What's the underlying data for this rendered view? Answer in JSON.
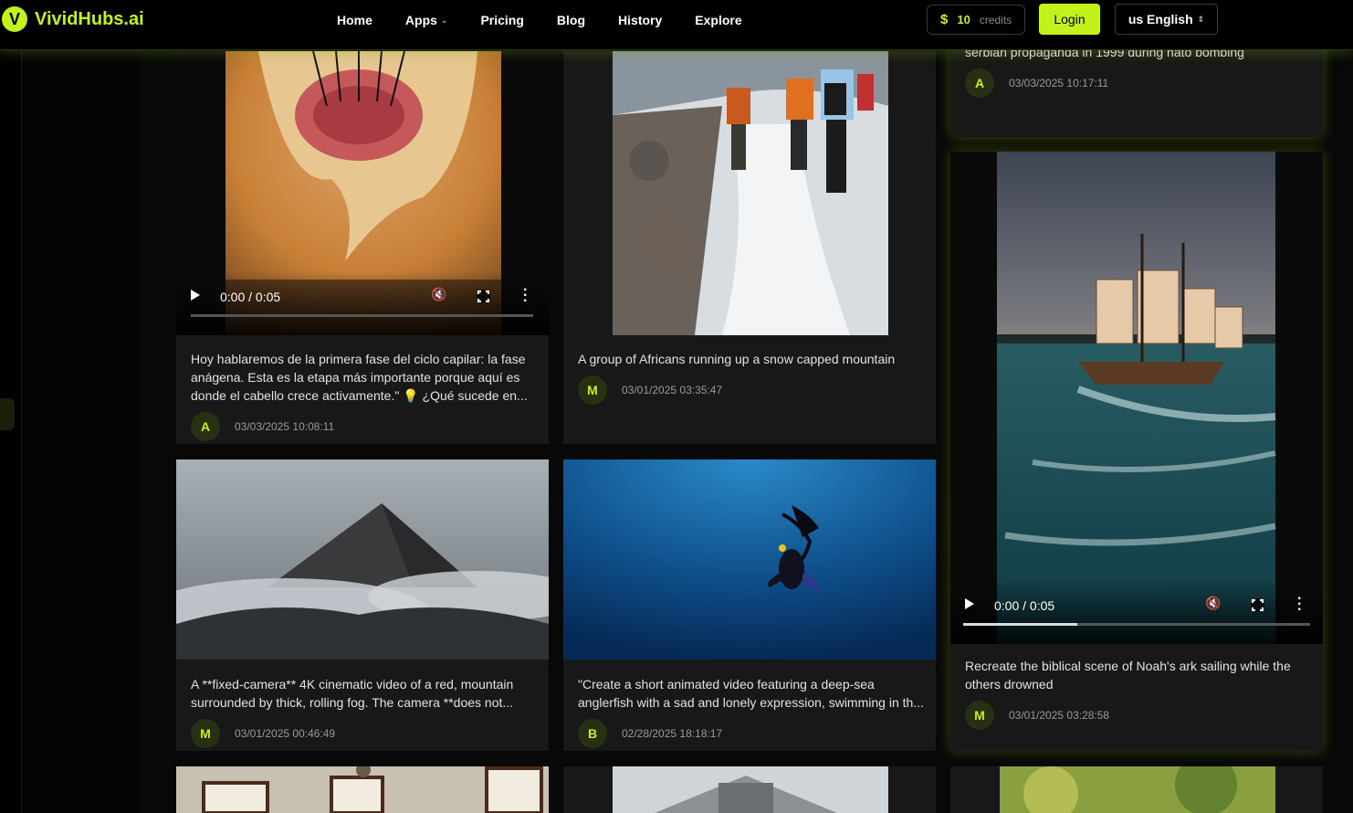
{
  "header": {
    "logo_mark": "V",
    "logo_text": "VividHubs.ai",
    "nav": [
      {
        "label": "Home"
      },
      {
        "label": "Apps",
        "has_dropdown": true
      },
      {
        "label": "Pricing"
      },
      {
        "label": "Blog"
      },
      {
        "label": "History"
      },
      {
        "label": "Explore"
      }
    ],
    "credits_symbol": "$",
    "credits_value": "10",
    "credits_label": "credits",
    "login_label": "Login",
    "language_label": "us English"
  },
  "cards": [
    {
      "id": "hair",
      "caption": "Hoy hablaremos de la primera fase del ciclo capilar: la fase anágena. Esta es la etapa más importante porque aquí es donde el cabello crece activamente.\" 💡 ¿Qué sucede en...",
      "avatar": "A",
      "date": "03/03/2025 10:08:11",
      "video_time": "0:00 / 0:05",
      "progress": 0
    },
    {
      "id": "snow",
      "caption": "A group of Africans running up a snow capped mountain",
      "avatar": "M",
      "date": "03/01/2025 03:35:47"
    },
    {
      "id": "serbian",
      "caption": "serbian propaganda in 1999 during nato bombing",
      "avatar": "A",
      "date": "03/03/2025 10:17:11"
    },
    {
      "id": "ark",
      "caption": "Recreate the biblical scene of Noah's ark sailing while the others drowned",
      "avatar": "M",
      "date": "03/01/2025 03:28:58",
      "video_time": "0:00 / 0:05",
      "progress": 0.33
    },
    {
      "id": "mountain",
      "caption": "A **fixed-camera** 4K cinematic video of a red, mountain surrounded by thick, rolling fog. The camera **does not...",
      "avatar": "M",
      "date": "03/01/2025 00:46:49"
    },
    {
      "id": "fish",
      "caption": "\"Create a short animated video featuring a deep-sea anglerfish with a sad and lonely expression, swimming in th...",
      "avatar": "B",
      "date": "02/28/2025 18:18:17"
    }
  ],
  "colors": {
    "accent": "#c3f21a",
    "card_bg": "#181818",
    "page_bg": "#000000"
  }
}
